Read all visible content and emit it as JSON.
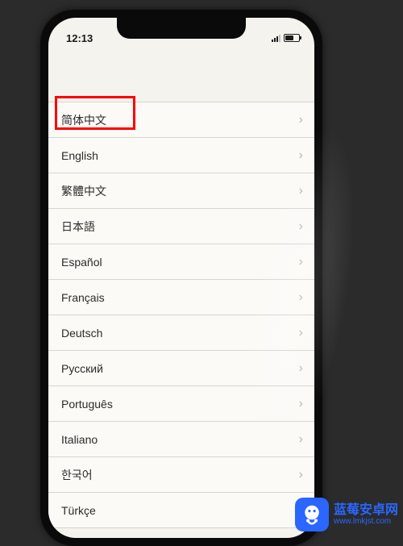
{
  "status": {
    "time": "12:13"
  },
  "list": {
    "items": [
      {
        "label": "简体中文"
      },
      {
        "label": "English"
      },
      {
        "label": "繁體中文"
      },
      {
        "label": "日本語"
      },
      {
        "label": "Español"
      },
      {
        "label": "Français"
      },
      {
        "label": "Deutsch"
      },
      {
        "label": "Русский"
      },
      {
        "label": "Português"
      },
      {
        "label": "Italiano"
      },
      {
        "label": "한국어"
      },
      {
        "label": "Türkçe"
      }
    ]
  },
  "watermark": {
    "title": "蓝莓安卓网",
    "url": "www.lmkjst.com"
  }
}
